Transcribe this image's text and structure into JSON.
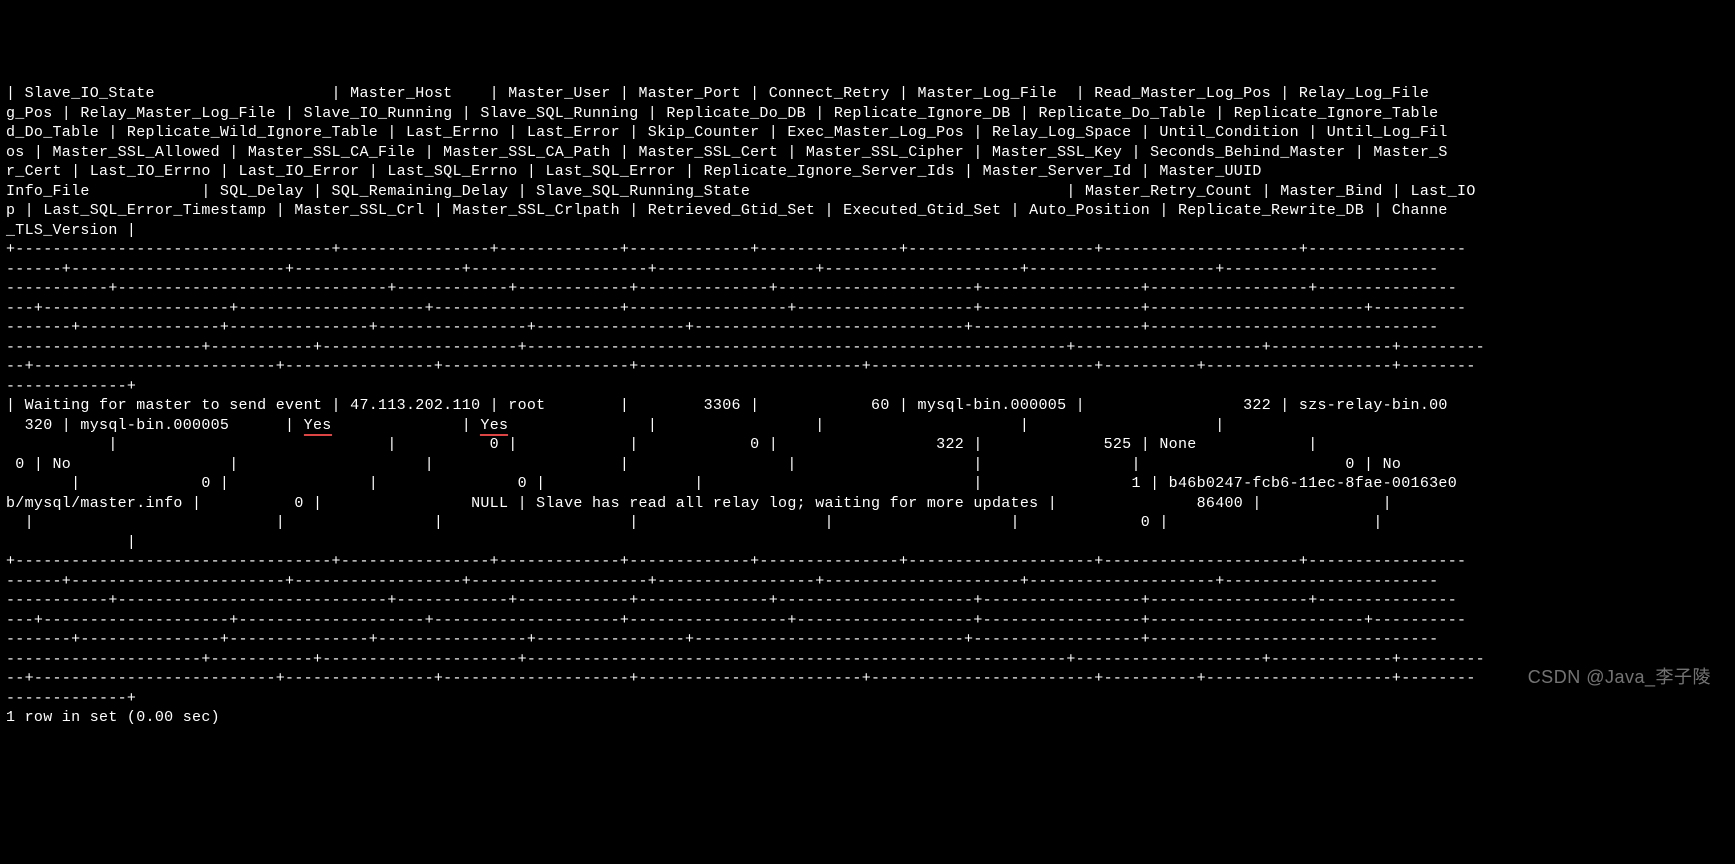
{
  "header_lines": [
    "| Slave_IO_State                   | Master_Host    | Master_User | Master_Port | Connect_Retry | Master_Log_File  | Read_Master_Log_Pos | Relay_Log_File",
    "g_Pos | Relay_Master_Log_File | Slave_IO_Running | Slave_SQL_Running | Replicate_Do_DB | Replicate_Ignore_DB | Replicate_Do_Table | Replicate_Ignore_Table",
    "d_Do_Table | Replicate_Wild_Ignore_Table | Last_Errno | Last_Error | Skip_Counter | Exec_Master_Log_Pos | Relay_Log_Space | Until_Condition | Until_Log_Fil",
    "os | Master_SSL_Allowed | Master_SSL_CA_File | Master_SSL_CA_Path | Master_SSL_Cert | Master_SSL_Cipher | Master_SSL_Key | Seconds_Behind_Master | Master_S",
    "r_Cert | Last_IO_Errno | Last_IO_Error | Last_SQL_Errno | Last_SQL_Error | Replicate_Ignore_Server_Ids | Master_Server_Id | Master_UUID",
    "Info_File            | SQL_Delay | SQL_Remaining_Delay | Slave_SQL_Running_State                                  | Master_Retry_Count | Master_Bind | Last_IO",
    "p | Last_SQL_Error_Timestamp | Master_SSL_Crl | Master_SSL_Crlpath | Retrieved_Gtid_Set | Executed_Gtid_Set | Auto_Position | Replicate_Rewrite_DB | Channe",
    "_TLS_Version |"
  ],
  "separator_lines": [
    "+----------------------------------+----------------+-------------+-------------+---------------+--------------------+---------------------+-----------------",
    "------+-----------------------+------------------+-------------------+-----------------+---------------------+--------------------+-----------------------",
    "-----------+-----------------------------+------------+------------+--------------+---------------------+-----------------+-----------------+---------------",
    "---+--------------------+--------------------+--------------------+-----------------+-------------------+-----------------+-----------------------+----------",
    "-------+---------------+---------------+----------------+----------------+-----------------------------+------------------+-------------------------------",
    "---------------------+-----------+---------------------+----------------------------------------------------------+--------------------+-------------+---------",
    "--+--------------------------+----------------+--------------------+------------------------+------------------------+----------+--------------------+--------",
    "-------------+"
  ],
  "data_row_1_pre": "| Waiting for master to send event | 47.113.202.110 | root        |        3306 |            60 | mysql-bin.000005 |",
  "data_row_1_post": "                 322 | szs-relay-bin.00",
  "data_row_2_pre": "  320 | mysql-bin.000005      | ",
  "data_row_2_yes1": "Yes",
  "data_row_2_mid": "              | ",
  "data_row_2_yes2": "Yes",
  "data_row_2_post": "               |                 |                     |                    |                       ",
  "data_row_3": "           |                             |          0 |            |            0 |                 322 |             525 | None            |",
  "data_row_4": " 0 | No                 |                    |                    |                 |                   |                |                      0 | No",
  "data_row_5": "       |             0 |               |               0 |                |                             |                1 | b46b0247-fcb6-11ec-8fae-00163e0",
  "data_row_6": "b/mysql/master.info |          0 |                NULL | Slave has read all relay log; waiting for more updates |               86400 |             |",
  "data_row_7": "  |                          |                |                    |                    |                   |             0 |                      |",
  "data_row_8": "             |",
  "footer": "1 row in set (0.00 sec)",
  "watermark": "CSDN @Java_李子陵"
}
